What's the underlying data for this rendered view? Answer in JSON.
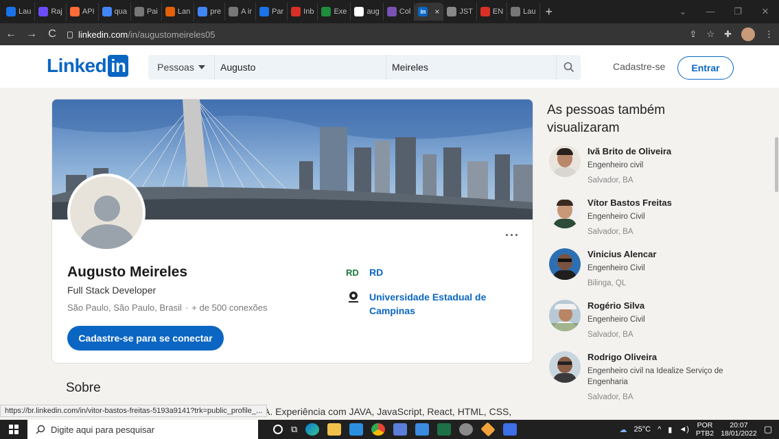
{
  "browser": {
    "tabs": [
      {
        "label": "Lau",
        "icon": "meet-icon",
        "color": "#1a73e8"
      },
      {
        "label": "Raj",
        "icon": "glitch-icon",
        "color": "#6b4cf5"
      },
      {
        "label": "API",
        "icon": "postman-icon",
        "color": "#ff6c37"
      },
      {
        "label": "qua",
        "icon": "google-icon",
        "color": "#4285f4"
      },
      {
        "label": "Pai",
        "icon": "globe-icon",
        "color": "#777777"
      },
      {
        "label": "Lan",
        "icon": "app-icon",
        "color": "#e36209"
      },
      {
        "label": "pre",
        "icon": "google-icon",
        "color": "#4285f4"
      },
      {
        "label": "A ir",
        "icon": "globe-icon",
        "color": "#777777"
      },
      {
        "label": "Par",
        "icon": "meet-icon",
        "color": "#1a73e8"
      },
      {
        "label": "Inb",
        "icon": "gmail-icon",
        "color": "#d93025"
      },
      {
        "label": "Exe",
        "icon": "classroom-icon",
        "color": "#1e8e3e"
      },
      {
        "label": "aug",
        "icon": "github-icon",
        "color": "#ffffff"
      },
      {
        "label": "Col",
        "icon": "bootstrap-icon",
        "color": "#7952b3"
      },
      {
        "label": "",
        "icon": "linkedin-icon",
        "color": "#0a66c2",
        "active": true
      },
      {
        "label": "JST",
        "icon": "app-icon",
        "color": "#888888"
      },
      {
        "label": "EN",
        "icon": "gmail-icon",
        "color": "#d93025"
      },
      {
        "label": "Lau",
        "icon": "globe-icon",
        "color": "#777777"
      }
    ],
    "active_tab_close": "×",
    "new_tab": "+",
    "url_host": "linkedin.com",
    "url_path": "/in/augustomeireles05"
  },
  "header": {
    "logo_text": "Linked",
    "logo_in": "in",
    "search_type": "Pessoas",
    "search_first": "Augusto",
    "search_last": "Meireles",
    "cadastre": "Cadastre-se",
    "entrar": "Entrar"
  },
  "profile": {
    "more": "···",
    "name": "Augusto Meireles",
    "headline": "Full Stack Developer",
    "location": "São Paulo, São Paulo, Brasil",
    "separator": "·",
    "connections": "+ de 500 conexões",
    "connect_button": "Cadastre-se para se conectar",
    "experience": [
      {
        "label": "RD",
        "icon": "rd-logo-icon"
      },
      {
        "label": "Universidade Estadual de Campinas",
        "icon": "university-logo-icon"
      }
    ]
  },
  "about": {
    "title": "Sobre",
    "text": "A. Experiência com JAVA, JavaScript, React, HTML, CSS,"
  },
  "sidebar": {
    "title": "As pessoas também visualizaram",
    "people": [
      {
        "name": "Ivã Brito de Oliveira",
        "title": "Engenheiro civil",
        "location": "Salvador, BA"
      },
      {
        "name": "Vítor Bastos Freitas",
        "title": "Engenheiro Civil",
        "location": "Salvador, BA"
      },
      {
        "name": "Vinicius Alencar",
        "title": "Engenheiro Civil",
        "location": "Bilinga, QL"
      },
      {
        "name": "Rogério Silva",
        "title": "Engenheiro Civil",
        "location": "Salvador, BA"
      },
      {
        "name": "Rodrigo Oliveira",
        "title": "Engenheiro civil na Idealize Serviço de Engenharia",
        "location": "Salvador, BA"
      }
    ]
  },
  "status_url": "https://br.linkedin.com/in/vitor-bastos-freitas-5193a9141?trk=public_profile_...",
  "taskbar": {
    "search_placeholder": "Digite aqui para pesquisar",
    "weather": "25°C",
    "lang_top": "POR",
    "lang_bottom": "PTB2",
    "time": "20:07",
    "date": "18/01/2022"
  }
}
